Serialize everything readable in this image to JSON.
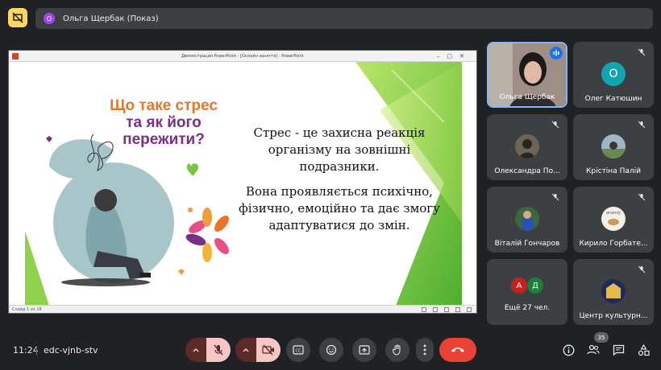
{
  "presenter_bar": {
    "avatar_letter": "О",
    "text": "Ольга Щербак (Показ)"
  },
  "ppt": {
    "window_title": "Демонстрация PowerPoint - [Онлайн заняття] - PowerPoint",
    "status": "Слайд 1 из 18"
  },
  "slide": {
    "title_line1": "Що таке стрес",
    "title_line2": "та як його",
    "title_line3": "пережити?",
    "body_para1": "Стрес - це захисна реакція організму на зовнішні подразники.",
    "body_para2": "Вона проявляється психічно, фізично, емоційно та дає змогу адаптуватися до змін."
  },
  "participants": [
    {
      "name": "Ольга Щербак",
      "type": "video",
      "speaking": true
    },
    {
      "name": "Олег Катюшин",
      "type": "letter",
      "letter": "О",
      "muted": true
    },
    {
      "name": "Олександра По...",
      "type": "photo",
      "muted": true
    },
    {
      "name": "Крістіна Палій",
      "type": "photo",
      "muted": true
    },
    {
      "name": "Віталій Гончаров",
      "type": "photo",
      "muted": true
    },
    {
      "name": "Кирило Горбате...",
      "type": "photo",
      "avatar_text": "arseniy",
      "muted": true
    },
    {
      "name": "Ещё 27 чел.",
      "type": "more",
      "letters": [
        "А",
        "Д"
      ]
    },
    {
      "name": "Центр культурн...",
      "type": "photo",
      "muted": true
    }
  ],
  "bottom": {
    "time": "11:24",
    "meeting_code": "edc-vjnb-stv",
    "participants_count": "35"
  },
  "colors": {
    "accent_yellow": "#fdd663",
    "end_call": "#ea4335",
    "speaking_blue": "#1a73e8",
    "avatar_teal": "#12a4af"
  }
}
